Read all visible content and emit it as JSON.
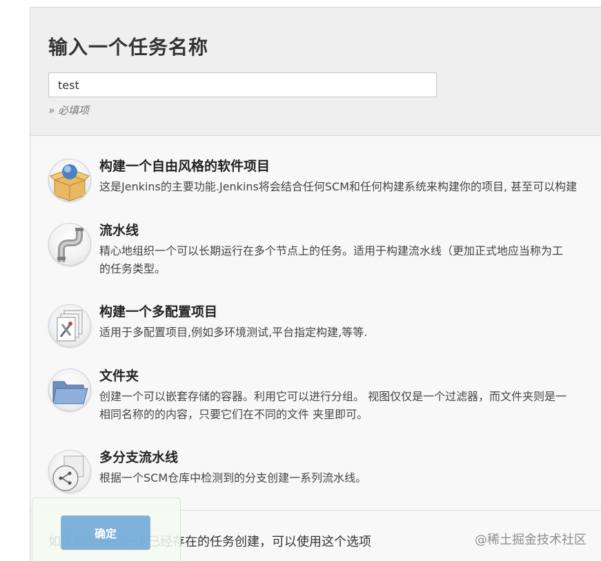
{
  "name_section": {
    "title": "输入一个任务名称",
    "input_value": "test",
    "required_note": "» 必填项"
  },
  "items": [
    {
      "title": "构建一个自由风格的软件项目",
      "desc": [
        "这是Jenkins的主要功能.Jenkins将会结合任何SCM和任何构建系统来构建你的项目, 甚至可以构建"
      ],
      "icon": "freestyle-box-icon"
    },
    {
      "title": "流水线",
      "desc": [
        "精心地组织一个可以长期运行在多个节点上的任务。适用于构建流水线（更加正式地应当称为工",
        "的任务类型。"
      ],
      "icon": "pipeline-icon"
    },
    {
      "title": "构建一个多配置项目",
      "desc": [
        "适用于多配置项目,例如多环境测试,平台指定构建,等等."
      ],
      "icon": "multi-config-icon"
    },
    {
      "title": "文件夹",
      "desc": [
        "创建一个可以嵌套存储的容器。利用它可以进行分组。 视图仅仅是一个过滤器，而文件夹则是一",
        "相同名称的的内容，只要它们在不同的文件 夹里即可。"
      ],
      "icon": "folder-icon"
    },
    {
      "title": "多分支流水线",
      "desc": [
        "根据一个SCM仓库中检测到的分支创建一系列流水线。"
      ],
      "icon": "multibranch-icon"
    }
  ],
  "copy_hint": "如果你想根据一个已经存在的任务创建，可以使用这个选项",
  "ok_button": "确定",
  "watermark": "@稀土掘金技术社区"
}
